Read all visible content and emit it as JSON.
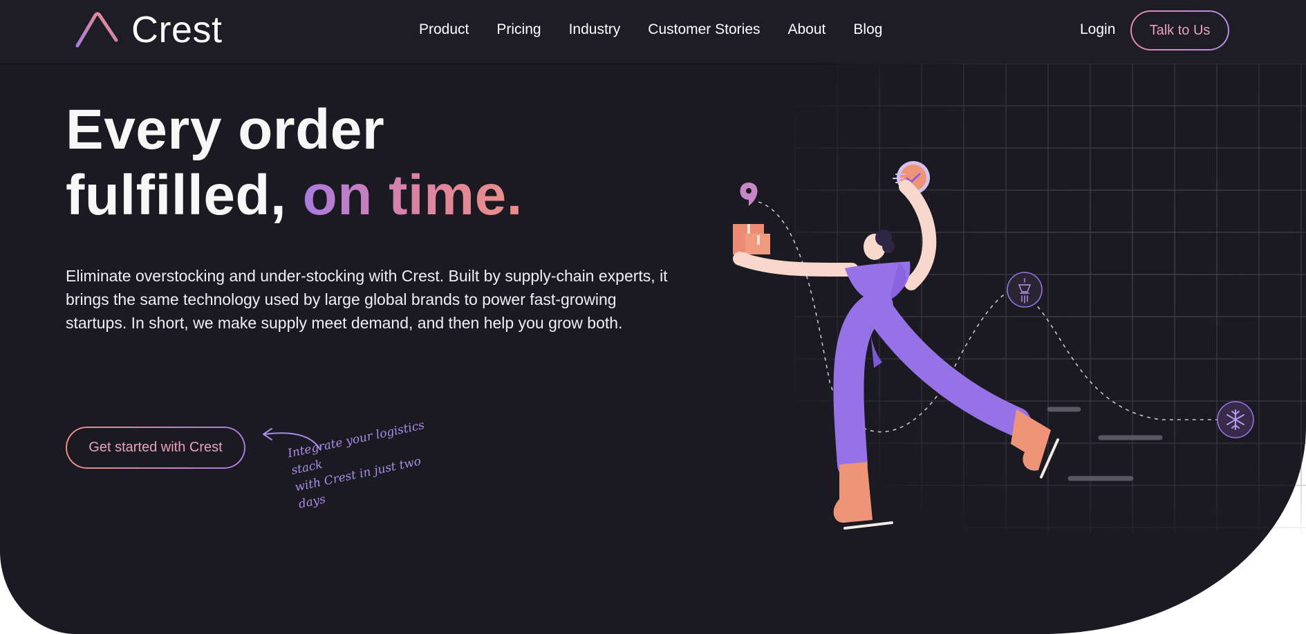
{
  "brand": {
    "name": "Crest",
    "accent_gradient": [
      "#a97be0",
      "#d984a4",
      "#ee8e86"
    ]
  },
  "nav": {
    "links": [
      "Product",
      "Pricing",
      "Industry",
      "Customer Stories",
      "About",
      "Blog"
    ],
    "login": "Login",
    "cta": "Talk to Us"
  },
  "hero": {
    "headline_line1": "Every order",
    "headline_line2_plain": "fulfilled,",
    "headline_line2_accent": "on time.",
    "description": "Eliminate overstocking and under-stocking with Crest. Built by supply-chain experts, it brings the same technology used by large global brands to power fast-growing startups. In short, we make supply meet demand, and then help you grow both.",
    "cta_button": "Get started with Crest",
    "cta_note_line1": "Integrate your logistics stack",
    "cta_note_line2": "with Crest in just two days"
  },
  "illustration": {
    "icons": [
      "location-pin-icon",
      "package-icon",
      "clock-check-icon",
      "lantern-icon",
      "snowflake-icon"
    ]
  },
  "colors": {
    "background": "#1b1921",
    "navbar": "#1e1c24",
    "purple": "#9572e6",
    "salmon": "#ee9478",
    "text": "#ffffff"
  }
}
